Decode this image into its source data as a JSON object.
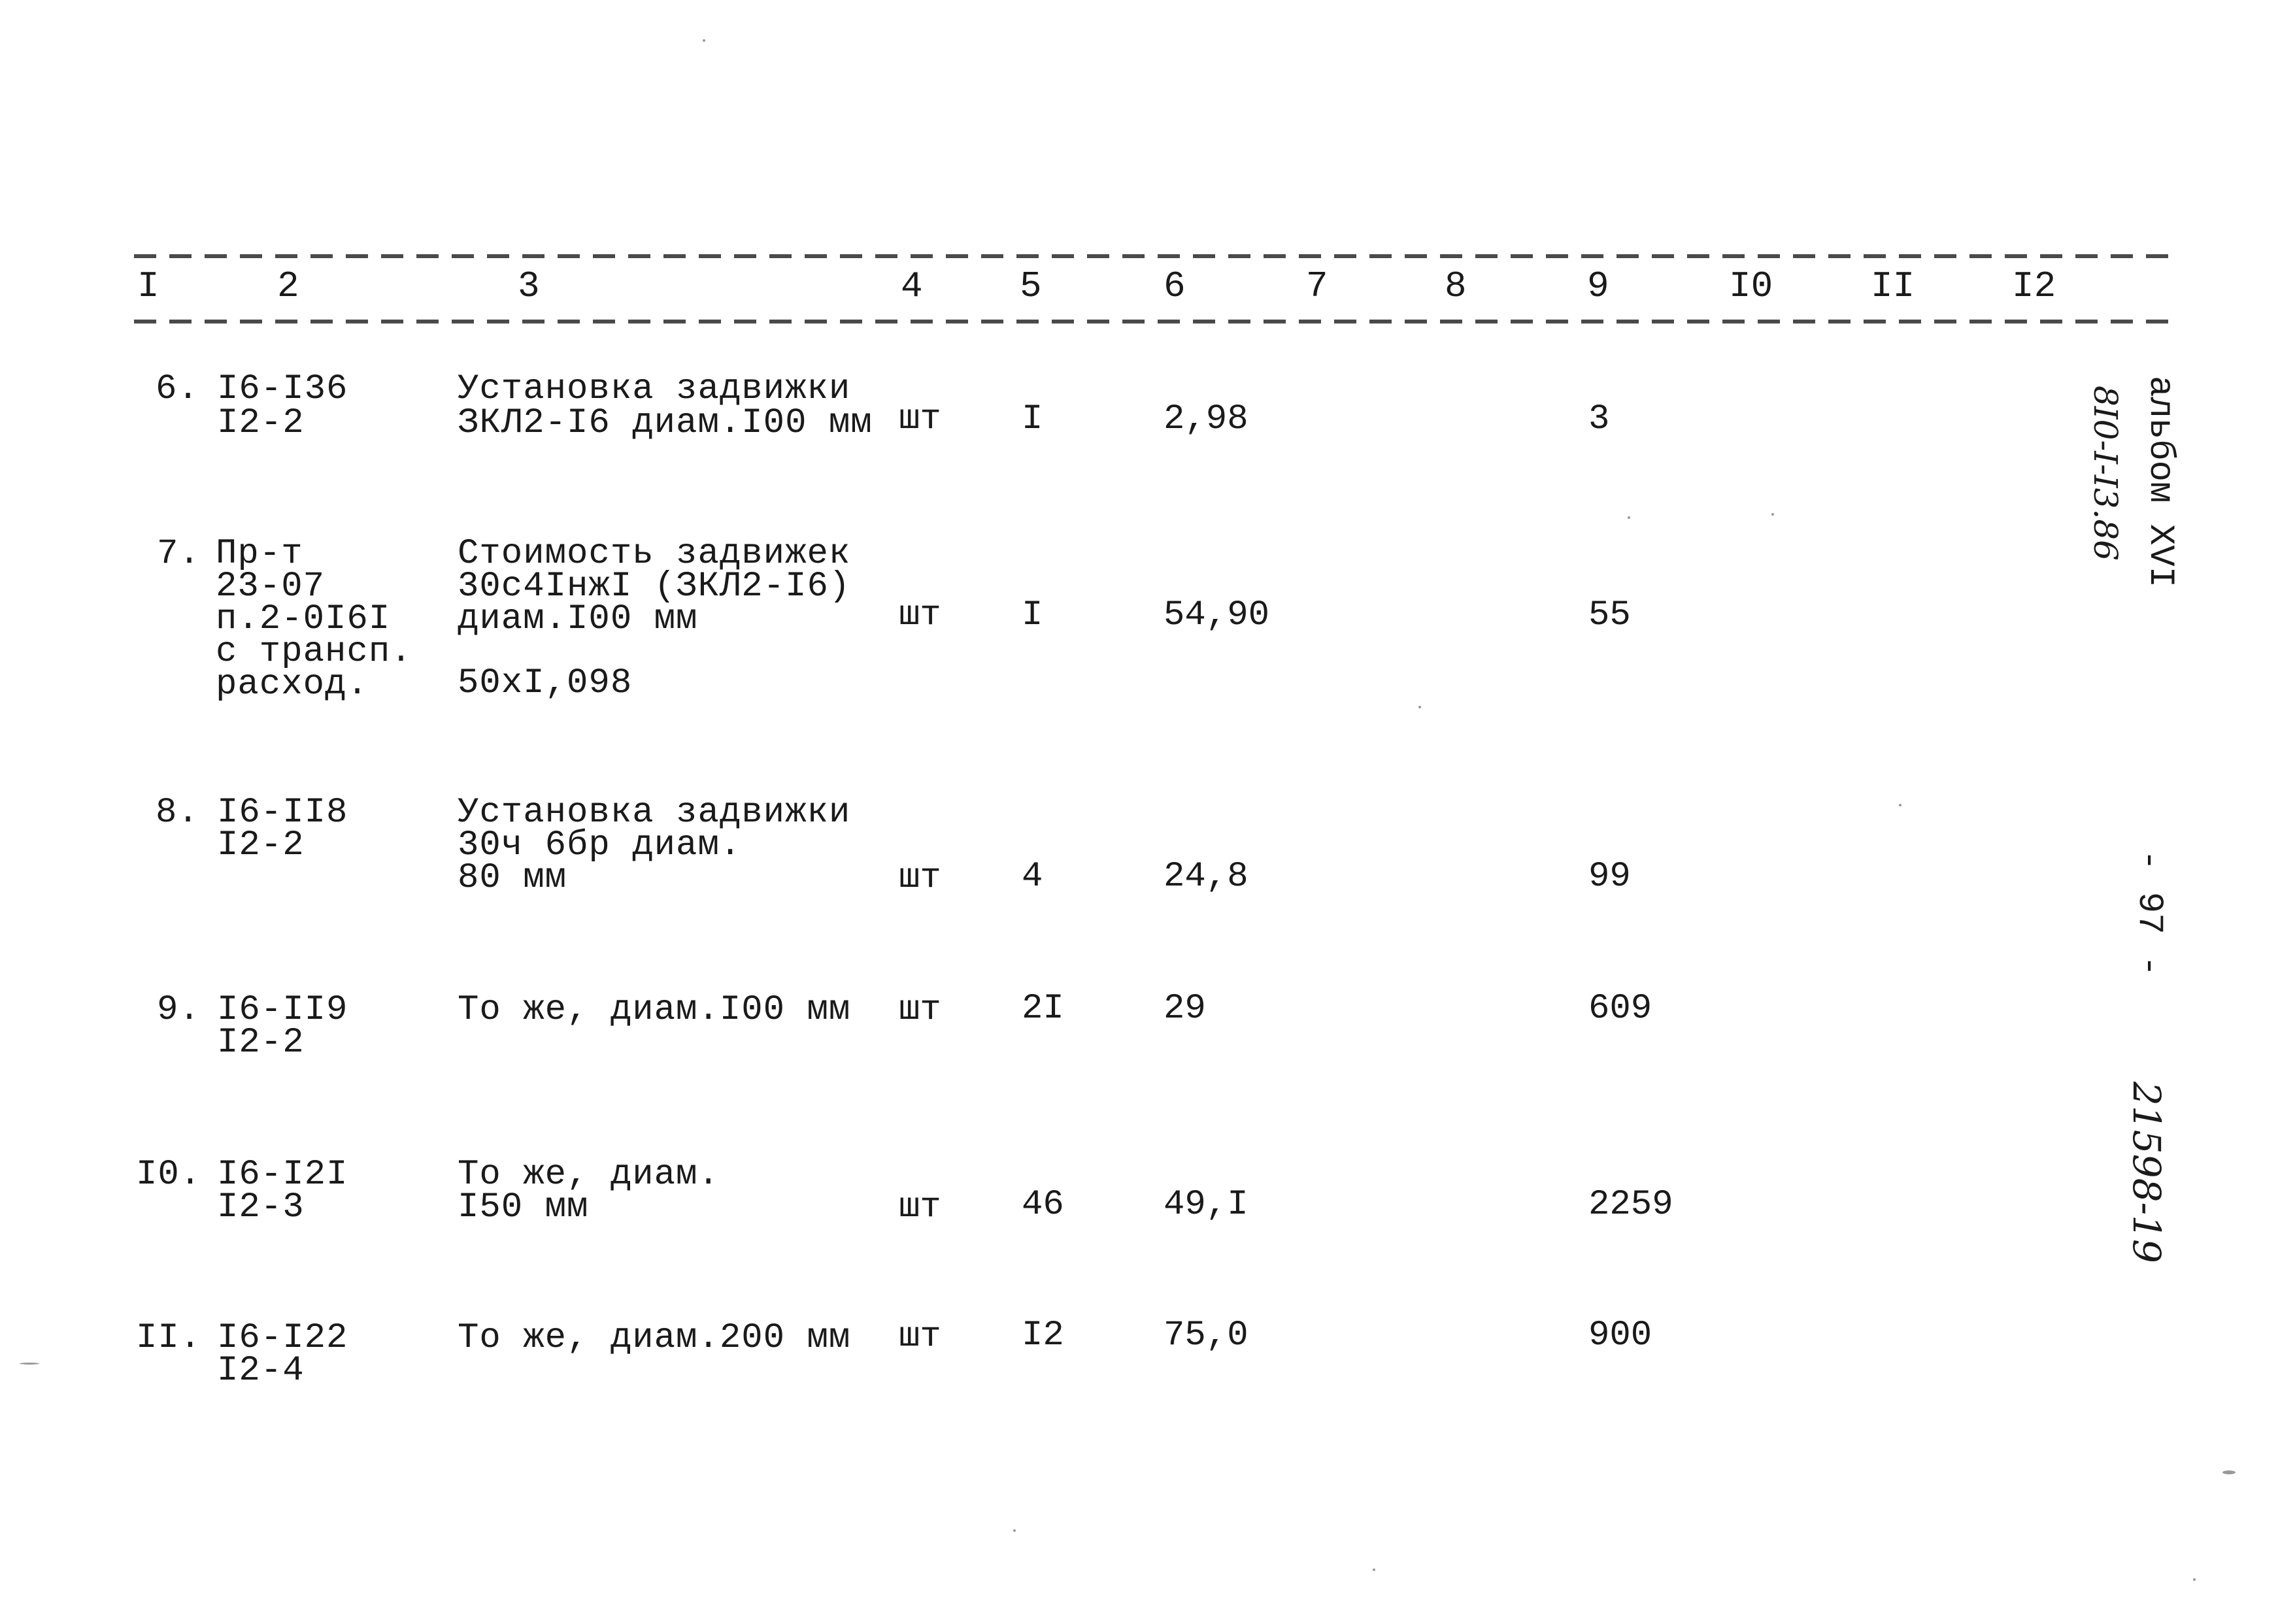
{
  "document": {
    "column_headers": [
      "I",
      "2",
      "3",
      "4",
      "5",
      "6",
      "7",
      "8",
      "9",
      "I0",
      "II",
      "I2"
    ],
    "rows": [
      {
        "number": "6.",
        "code_lines": [
          "I6-I36",
          "I2-2"
        ],
        "description_lines": [
          "Установка задвижки",
          "ЗКЛ2-I6 диам.I00 мм"
        ],
        "extra_line": "",
        "unit": "шт",
        "quantity": "I",
        "unit_cost": "2,98",
        "total": "3"
      },
      {
        "number": "7.",
        "code_lines": [
          "Пр-т",
          "23-07",
          "п.2-0I6I",
          "с трансп.",
          "расход."
        ],
        "description_lines": [
          "Стоимость задвижек",
          "30с4IнжI (ЗКЛ2-I6)",
          "диам.I00 мм"
        ],
        "extra_line": "50хI,098",
        "unit": "шт",
        "quantity": "I",
        "unit_cost": "54,90",
        "total": "55"
      },
      {
        "number": "8.",
        "code_lines": [
          "I6-II8",
          "I2-2"
        ],
        "description_lines": [
          "Установка задвижки",
          "30ч 6бр диам.",
          "80 мм"
        ],
        "extra_line": "",
        "unit": "шт",
        "quantity": "4",
        "unit_cost": "24,8",
        "total": "99"
      },
      {
        "number": "9.",
        "code_lines": [
          "I6-II9",
          "I2-2"
        ],
        "description_lines": [
          "То же, диам.I00 мм"
        ],
        "extra_line": "",
        "unit": "шт",
        "quantity": "2I",
        "unit_cost": "29",
        "total": "609"
      },
      {
        "number": "I0.",
        "code_lines": [
          "I6-I2I",
          "I2-3"
        ],
        "description_lines": [
          "То же, диам.",
          "I50 мм"
        ],
        "extra_line": "",
        "unit": "шт",
        "quantity": "46",
        "unit_cost": "49,I",
        "total": "2259"
      },
      {
        "number": "II.",
        "code_lines": [
          "I6-I22",
          "I2-4"
        ],
        "description_lines": [
          "То же, диам.200 мм"
        ],
        "extra_line": "",
        "unit": "шт",
        "quantity": "I2",
        "unit_cost": "75,0",
        "total": "900"
      }
    ],
    "margin": {
      "album_label": "альбом XVI",
      "album_code_handwritten": "8I0-I-I3.86",
      "page_number": "- 97 -",
      "archive_number_handwritten": "21598-19"
    }
  }
}
